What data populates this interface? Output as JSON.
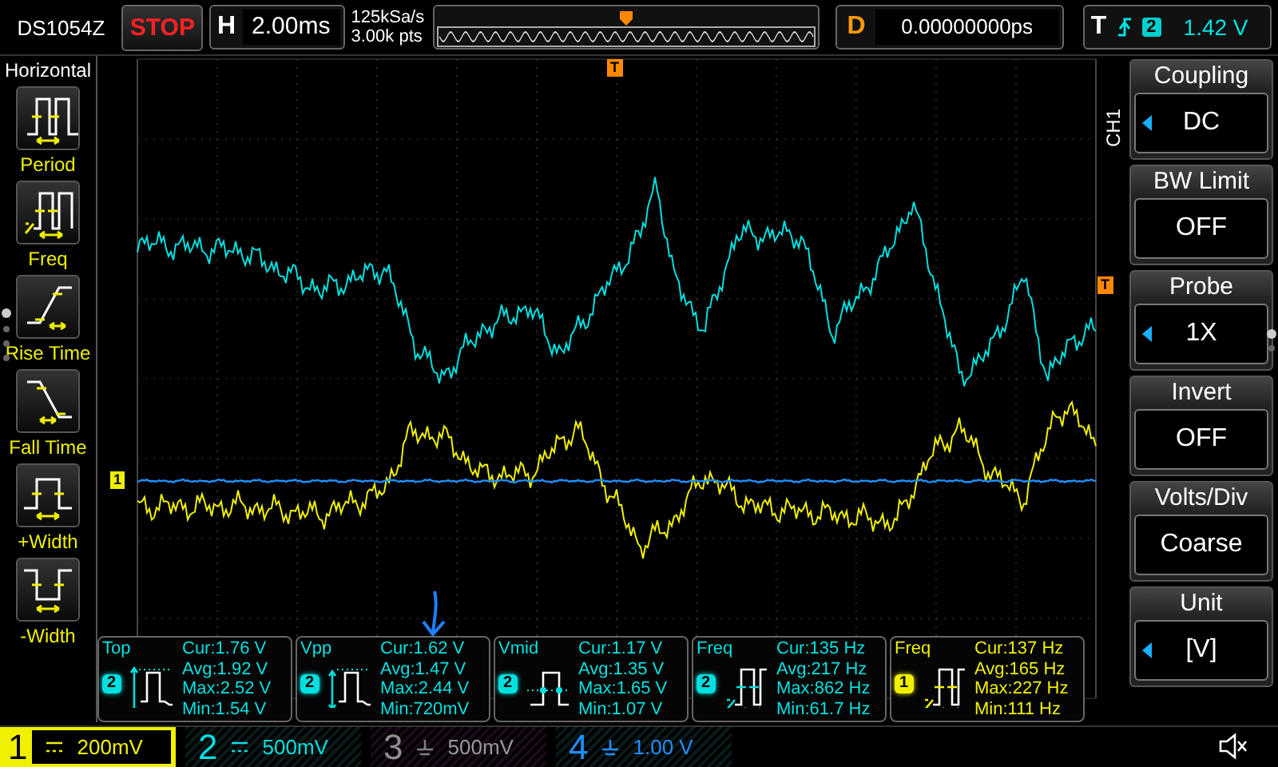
{
  "top_bar": {
    "model": "DS1054Z",
    "run_status": "STOP",
    "timebase_label": "H",
    "timebase": "2.00ms",
    "sample_rate": "125kSa/s",
    "memory_depth": "3.00k pts",
    "delay_label": "D",
    "delay": "0.00000000ps",
    "trigger_label": "T",
    "trigger_source": "2",
    "trigger_level": "1.42 V"
  },
  "left_menu": {
    "title": "Horizontal",
    "items": [
      {
        "kind": "period",
        "label": "Period"
      },
      {
        "kind": "freq",
        "label": "Freq"
      },
      {
        "kind": "rise",
        "label": "Rise Time"
      },
      {
        "kind": "fall",
        "label": "Fall Time"
      },
      {
        "kind": "pwidth",
        "label": "+Width"
      },
      {
        "kind": "nwidth",
        "label": "-Width"
      }
    ]
  },
  "plot": {
    "trigger_position_marker": "T",
    "trigger_level_marker": "T",
    "channel_marker": "1"
  },
  "measurements": [
    {
      "kind": "top",
      "name": "Top",
      "channel": "2",
      "color": "#00e0e0",
      "cur": "Cur:1.76 V",
      "avg": "Avg:1.92 V",
      "max": "Max:2.52 V",
      "min": "Min:1.54 V"
    },
    {
      "kind": "vpp",
      "name": "Vpp",
      "channel": "2",
      "color": "#00e0e0",
      "cur": "Cur:1.62 V",
      "avg": "Avg:1.47 V",
      "max": "Max:2.44 V",
      "min": "Min:720mV"
    },
    {
      "kind": "vmid",
      "name": "Vmid",
      "channel": "2",
      "color": "#00e0e0",
      "cur": "Cur:1.17 V",
      "avg": "Avg:1.35 V",
      "max": "Max:1.65 V",
      "min": "Min:1.07 V"
    },
    {
      "kind": "freq",
      "name": "Freq",
      "channel": "2",
      "color": "#00e0e0",
      "cur": "Cur:135 Hz",
      "avg": "Avg:217 Hz",
      "max": "Max:862 Hz",
      "min": "Min:61.7 Hz"
    },
    {
      "kind": "freq",
      "name": "Freq",
      "channel": "1",
      "color": "#f0f000",
      "cur": "Cur:137 Hz",
      "avg": "Avg:165 Hz",
      "max": "Max:227 Hz",
      "min": "Min:111 Hz"
    }
  ],
  "right_menu": {
    "channel": "CH1",
    "items": [
      {
        "title": "Coupling",
        "value": "DC",
        "arrow": true
      },
      {
        "title": "BW Limit",
        "value": "OFF",
        "arrow": false
      },
      {
        "title": "Probe",
        "value": "1X",
        "arrow": true
      },
      {
        "title": "Invert",
        "value": "OFF",
        "arrow": false
      },
      {
        "title": "Volts/Div",
        "value": "Coarse",
        "arrow": false
      },
      {
        "title": "Unit",
        "value": "[V]",
        "arrow": true
      }
    ]
  },
  "channels": [
    {
      "number": "1",
      "scale": "200mV",
      "kind": "dc",
      "color": "#f0f000",
      "selected": true,
      "enabled": true
    },
    {
      "number": "2",
      "scale": "500mV",
      "kind": "dc",
      "color": "#00e0e0",
      "selected": false,
      "enabled": true
    },
    {
      "number": "3",
      "scale": "500mV",
      "kind": "gnd",
      "color": "#909090",
      "selected": false,
      "enabled": false
    },
    {
      "number": "4",
      "scale": "1.00 V",
      "kind": "gnd",
      "color": "#1e90ff",
      "selected": false,
      "enabled": true
    }
  ]
}
